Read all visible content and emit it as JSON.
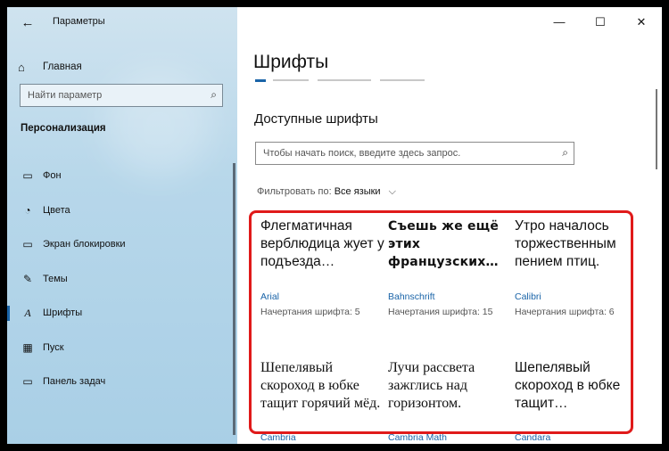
{
  "window": {
    "title": "Параметры"
  },
  "controls": {
    "minimize": "—",
    "maximize": "☐",
    "close": "✕"
  },
  "sidebar": {
    "home_label": "Главная",
    "search_placeholder": "Найти параметр",
    "section_title": "Персонализация",
    "items": [
      {
        "label": "Фон",
        "icon": "image-icon",
        "glyph": "▭"
      },
      {
        "label": "Цвета",
        "icon": "palette-icon",
        "glyph": "◔"
      },
      {
        "label": "Экран блокировки",
        "icon": "lock-screen-icon",
        "glyph": "▭"
      },
      {
        "label": "Темы",
        "icon": "themes-icon",
        "glyph": "✎"
      },
      {
        "label": "Шрифты",
        "icon": "fonts-icon",
        "glyph": "A"
      },
      {
        "label": "Пуск",
        "icon": "start-icon",
        "glyph": "▦"
      },
      {
        "label": "Панель задач",
        "icon": "taskbar-icon",
        "glyph": "▭"
      }
    ],
    "active_index": 4
  },
  "main": {
    "title": "Шрифты",
    "available_title": "Доступные шрифты",
    "search_placeholder": "Чтобы начать поиск, введите здесь запрос.",
    "filter_label": "Фильтровать по:",
    "filter_value": "Все языки",
    "fonts": [
      {
        "sample": "Флегматичная верблюдица жует у подъезда…",
        "name": "Arial",
        "styles": "Начертания шрифта: 5"
      },
      {
        "sample": "Съешь же ещё этих французских…",
        "name": "Bahnschrift",
        "styles": "Начертания шрифта: 15"
      },
      {
        "sample": "Утро началось торжественным пением птиц.",
        "name": "Calibri",
        "styles": "Начертания шрифта: 6"
      },
      {
        "sample": "Шепелявый скороход в юбке тащит горячий мёд.",
        "name": "Cambria",
        "styles": ""
      },
      {
        "sample": "Лучи рассвета зажглись над горизонтом.",
        "name": "Cambria Math",
        "styles": ""
      },
      {
        "sample": "Шепелявый скороход в юбке тащит…",
        "name": "Candara",
        "styles": ""
      }
    ],
    "highlight_color": "#e01a1a",
    "accent_color": "#1a64a8"
  }
}
